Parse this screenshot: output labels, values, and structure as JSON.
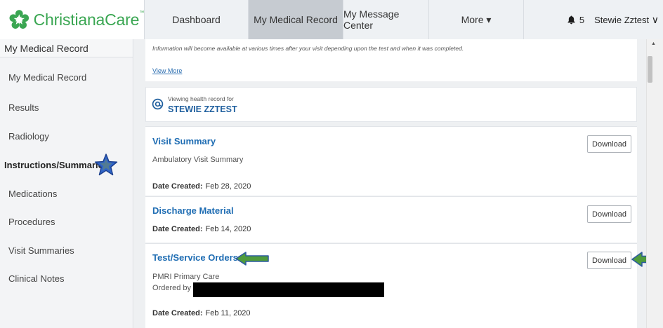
{
  "brand": {
    "logo_text": "ChristianaCare",
    "tm": "™"
  },
  "nav": {
    "items": [
      "Dashboard",
      "My Medical Record",
      "My Message Center",
      "More ▾"
    ],
    "active": "My Medical Record",
    "notifications_count": "5",
    "user_name": "Stewie Zztest",
    "user_chevron": "∨"
  },
  "sidebar": {
    "title": "My Medical Record",
    "items": [
      "My Medical Record",
      "Results",
      "Radiology",
      "Instructions/Summaries",
      "Medications",
      "Procedures",
      "Visit Summaries",
      "Clinical Notes"
    ],
    "selected": "Instructions/Summaries"
  },
  "info": {
    "text": "Information will become available at various times after your visit depending upon the test and when it was completed.",
    "view_more": "View More"
  },
  "patient": {
    "viewing_label": "Viewing health record for",
    "name": "STEWIE ZZTEST"
  },
  "records": [
    {
      "title": "Visit Summary",
      "subtitle": "Ambulatory Visit Summary",
      "date_label": "Date Created:",
      "date": "Feb 28, 2020",
      "download": "Download"
    },
    {
      "title": "Discharge Material",
      "date_label": "Date Created:",
      "date": "Feb 14, 2020",
      "download": "Download"
    },
    {
      "title": "Test/Service Orders",
      "subtitle": "PMRI Primary Care",
      "ordered_by": "Ordered by",
      "date_label": "Date Created:",
      "date": "Feb 11, 2020",
      "download": "Download"
    }
  ],
  "colors": {
    "brand_green": "#3aa652",
    "link_blue": "#1f6db3",
    "nav_active": "#c6cbd1",
    "annotation_star": "#2f63c8",
    "annotation_arrow": "#4f9b3c"
  }
}
